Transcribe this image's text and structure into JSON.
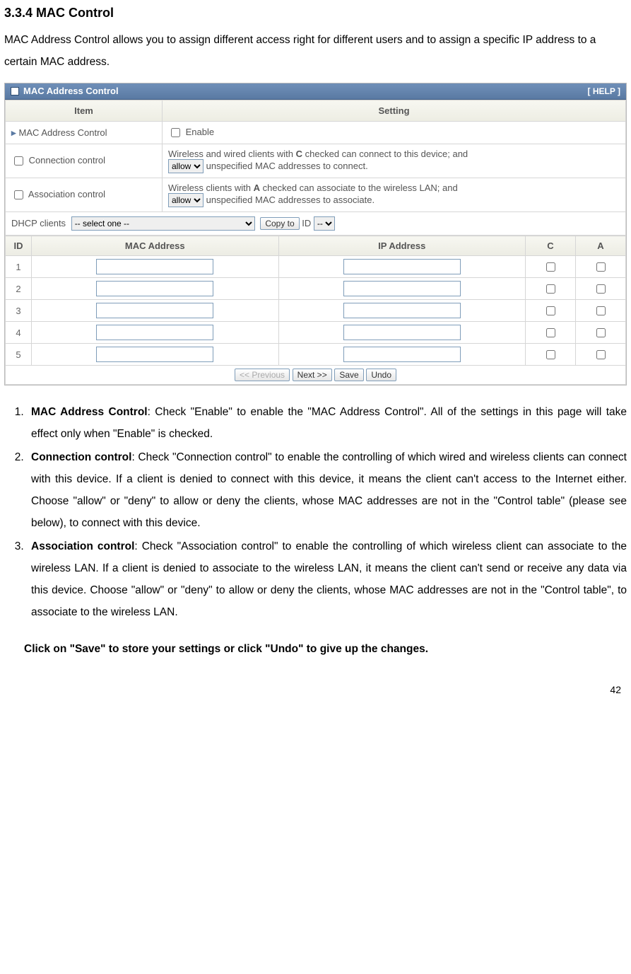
{
  "section_title": "3.3.4 MAC Control",
  "intro": "MAC Address Control allows you to assign different access right for different users and to assign a specific IP address to a certain MAC address.",
  "panel": {
    "title": "MAC Address Control",
    "help": "[ HELP ]",
    "headers": {
      "item": "Item",
      "setting": "Setting"
    },
    "rows": {
      "mac_control": {
        "label": "MAC Address Control",
        "enable_label": "Enable"
      },
      "connection": {
        "label": "Connection control",
        "line1_pre": "Wireless and wired clients with ",
        "line1_bold": "C",
        "line1_post": " checked can connect to this device; and",
        "select": "allow",
        "line2": "unspecified MAC addresses to connect."
      },
      "association": {
        "label": "Association control",
        "line1_pre": "Wireless clients with ",
        "line1_bold": "A",
        "line1_post": " checked can associate to the wireless LAN; and",
        "select": "allow",
        "line2": "unspecified MAC addresses to associate."
      },
      "dhcp": {
        "label": "DHCP clients",
        "select": "-- select one --",
        "copy_btn": "Copy to",
        "id_label": "ID",
        "id_select": "--"
      }
    },
    "grid": {
      "headers": {
        "id": "ID",
        "mac": "MAC Address",
        "ip": "IP Address",
        "c": "C",
        "a": "A"
      },
      "rows": [
        {
          "id": "1"
        },
        {
          "id": "2"
        },
        {
          "id": "3"
        },
        {
          "id": "4"
        },
        {
          "id": "5"
        }
      ]
    },
    "footer": {
      "prev": "<< Previous",
      "next": "Next >>",
      "save": "Save",
      "undo": "Undo"
    }
  },
  "list": {
    "n1": "1.",
    "n2": "2.",
    "n3": "3.",
    "i1_bold": "MAC Address Control",
    "i1_text": ": Check \"Enable\" to enable the \"MAC Address Control\". All of the settings in this page will take effect only when \"Enable\" is checked.",
    "i2_bold": "Connection control",
    "i2_text": ": Check \"Connection control\" to enable the controlling of which wired and wireless clients can connect with this device. If a client is denied to connect with this device, it means the client can't access to the Internet either. Choose \"allow\" or \"deny\" to allow or deny the clients, whose MAC addresses are not in the \"Control table\" (please see below), to connect with this device.",
    "i3_bold": "Association control",
    "i3_text": ": Check \"Association control\" to enable the controlling of which wireless client can associate to the wireless LAN. If a client is denied to associate to the wireless LAN, it means the client can't send or receive any data via this device. Choose \"allow\" or \"deny\" to allow or deny the clients, whose MAC addresses are not in the \"Control table\", to associate to the wireless LAN."
  },
  "closing": "Click on \"Save\" to store your settings or click \"Undo\" to give up the changes.",
  "page_number": "42"
}
